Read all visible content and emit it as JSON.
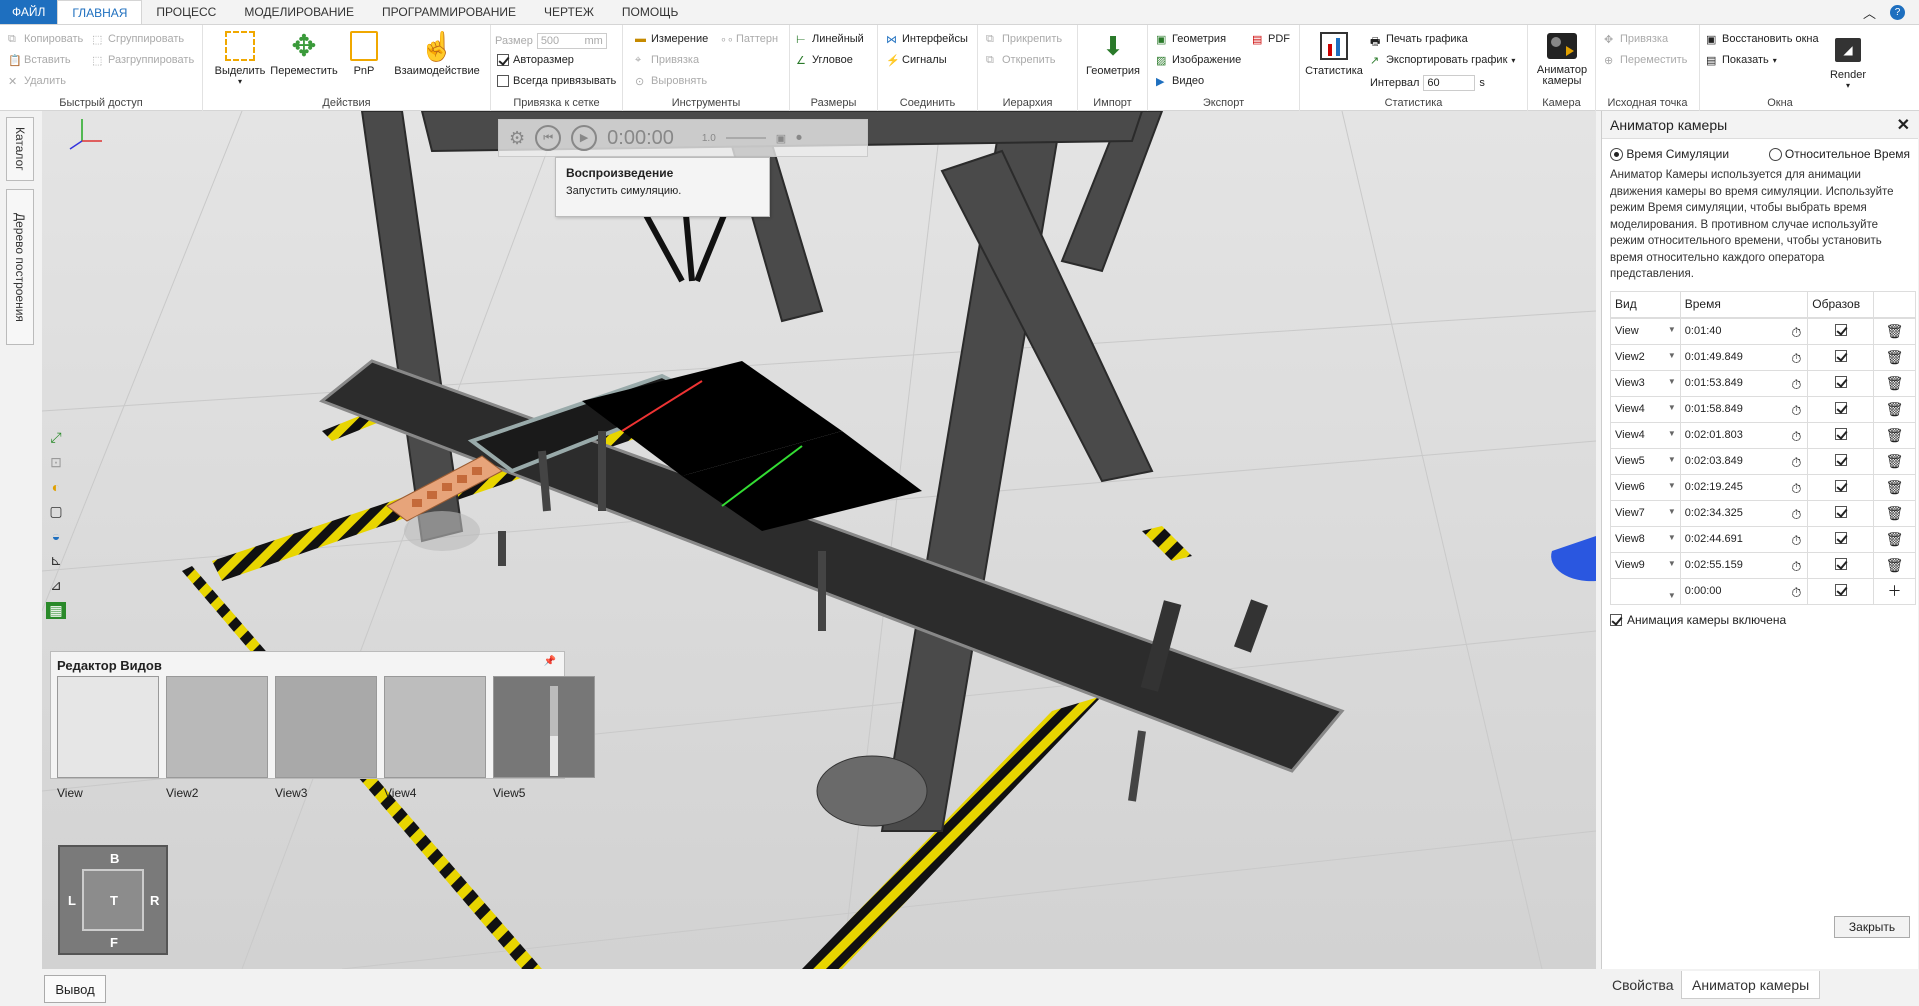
{
  "menubar": {
    "file": "ФАЙЛ",
    "tabs": [
      "ГЛАВНАЯ",
      "ПРОЦЕСС",
      "МОДЕЛИРОВАНИЕ",
      "ПРОГРАММИРОВАНИЕ",
      "ЧЕРТЕЖ",
      "ПОМОЩЬ"
    ]
  },
  "ribbon": {
    "quick": {
      "copy": "Копировать",
      "paste": "Вставить",
      "delete": "Удалить",
      "group": "Сгруппировать",
      "ungroup": "Разгруппировать",
      "title": "Быстрый доступ"
    },
    "actions": {
      "select": "Выделить",
      "move": "Переместить",
      "pnp": "PnP",
      "interact": "Взаимодействие",
      "title": "Действия"
    },
    "snap": {
      "size_label": "Размер",
      "size_value": "500",
      "unit": "mm",
      "autosize": "Авторазмер",
      "always_snap": "Всегда привязывать",
      "title": "Привязка к сетке"
    },
    "tools": {
      "measure": "Измерение",
      "pattern": "Паттерн",
      "snap": "Привязка",
      "align": "Выровнять",
      "title": "Инструменты"
    },
    "dims": {
      "linear": "Линейный",
      "angular": "Угловое",
      "title": "Размеры"
    },
    "connect": {
      "interfaces": "Интерфейсы",
      "signals": "Сигналы",
      "title": "Соединить"
    },
    "hier": {
      "attach": "Прикрепить",
      "detach": "Открепить",
      "title": "Иерархия"
    },
    "import": {
      "geometry": "Геометрия",
      "title": "Импорт"
    },
    "export": {
      "geometry": "Геометрия",
      "image": "Изображение",
      "video": "Видео",
      "pdf": "PDF",
      "title": "Экспорт"
    },
    "stats": {
      "stats": "Статистика",
      "print": "Печать графика",
      "export": "Экспортировать график",
      "interval_label": "Интервал",
      "interval_value": "60",
      "unit": "s",
      "title": "Статистика"
    },
    "camera": {
      "animator": "Аниматор камеры",
      "title": "Камера"
    },
    "origin": {
      "snap": "Привязка",
      "move": "Переместить",
      "title": "Исходная точка"
    },
    "window": {
      "restore": "Восстановить окна",
      "show": "Показать",
      "render": "Render",
      "title": "Окна"
    }
  },
  "left_tabs": {
    "catalog": "Каталог",
    "tree": "Дерево построения"
  },
  "playback": {
    "time": "0:00:00",
    "speed": "1.0"
  },
  "tooltip": {
    "title": "Воспроизведение",
    "text": "Запустить симуляцию."
  },
  "view_editor": {
    "title": "Редактор Видов",
    "views": [
      "View",
      "View2",
      "View3",
      "View4",
      "View5"
    ]
  },
  "view_cube": {
    "top": "B",
    "left": "L",
    "center": "T",
    "right": "R",
    "bottom": "F"
  },
  "panel": {
    "title": "Аниматор камеры",
    "radio_sim": "Время Симуляции",
    "radio_rel": "Относительное Время",
    "description": "Аниматор Камеры используется для анимации движения камеры во время симуляции. Используйте режим Время симуляции, чтобы выбрать время моделирования. В противном случае используйте режим относительного времени, чтобы установить время относительно каждого оператора представления.",
    "col_view": "Вид",
    "col_time": "Время",
    "col_sample": "Образов",
    "rows": [
      {
        "view": "View",
        "time": "0:01:40"
      },
      {
        "view": "View2",
        "time": "0:01:49.849"
      },
      {
        "view": "View3",
        "time": "0:01:53.849"
      },
      {
        "view": "View4",
        "time": "0:01:58.849"
      },
      {
        "view": "View4",
        "time": "0:02:01.803"
      },
      {
        "view": "View5",
        "time": "0:02:03.849"
      },
      {
        "view": "View6",
        "time": "0:02:19.245"
      },
      {
        "view": "View7",
        "time": "0:02:34.325"
      },
      {
        "view": "View8",
        "time": "0:02:44.691"
      },
      {
        "view": "View9",
        "time": "0:02:55.159"
      },
      {
        "view": "",
        "time": "0:00:00"
      }
    ],
    "enabled": "Анимация камеры включена",
    "close": "Закрыть"
  },
  "bottom": {
    "output": "Вывод",
    "tab_props": "Свойства",
    "tab_animator": "Аниматор камеры"
  }
}
